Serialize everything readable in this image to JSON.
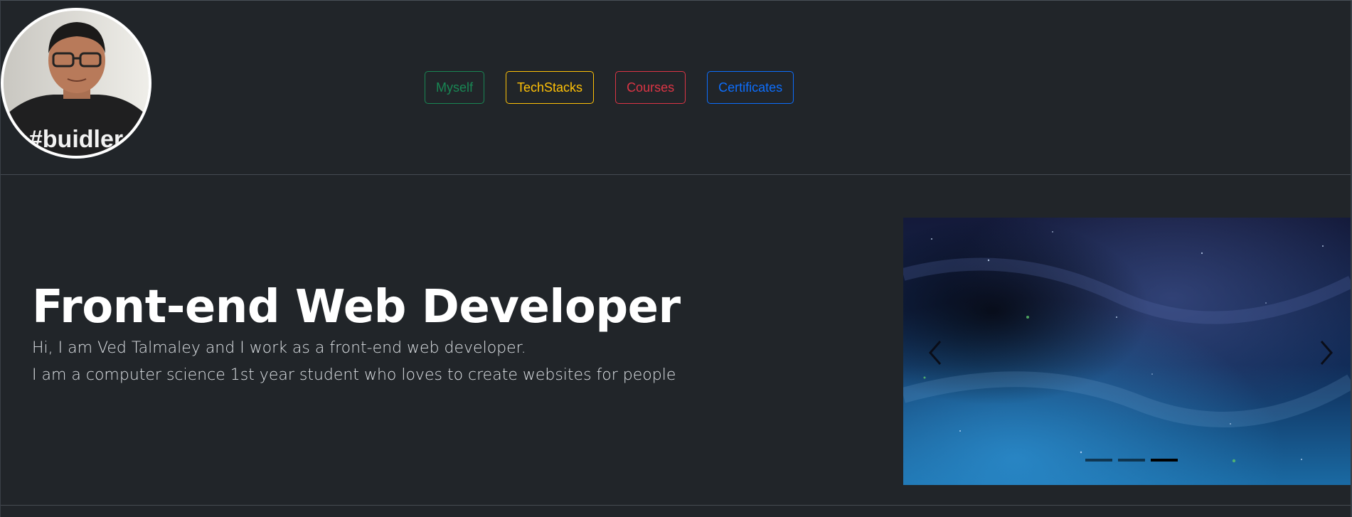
{
  "header": {
    "avatar_shirt_text": "#buidler",
    "nav": [
      {
        "label": "Myself",
        "color": "#198754"
      },
      {
        "label": "TechStacks",
        "color": "#ffc107"
      },
      {
        "label": "Courses",
        "color": "#dc3545"
      },
      {
        "label": "Certificates",
        "color": "#0d6efd"
      }
    ]
  },
  "hero": {
    "title": "Front-end Web Developer",
    "line1": "Hi, I am Ved Talmaley and I work as a front-end web developer.",
    "line2": "I am a computer science 1st year student who loves to create websites for people"
  },
  "carousel": {
    "prev_icon": "chevron-left-icon",
    "next_icon": "chevron-right-icon",
    "slide_count": 3,
    "active_slide": 3
  },
  "colors": {
    "background": "#212529",
    "title": "#ffffff",
    "text": "#dee2e6"
  }
}
